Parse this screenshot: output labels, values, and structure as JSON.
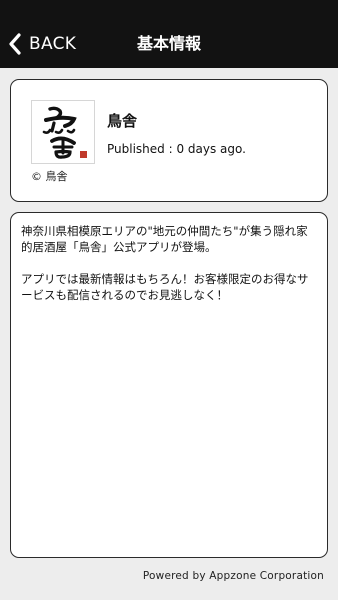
{
  "nav": {
    "back_label": "BACK",
    "title": "基本情報",
    "back_icon": "chevron-left-icon"
  },
  "app": {
    "name": "鳥舎",
    "published": "Published : 0 days ago.",
    "copyright": "© 鳥舎",
    "logo_text": "鳥舎"
  },
  "description": {
    "text": "神奈川県相模原エリアの\"地元の仲間たち\"が集う隠れ家的居酒屋「鳥舎」公式アプリが登場。\n\nアプリでは最新情報はもちろん！お客様限定のお得なサービスも配信されるのでお見逃しなく！"
  },
  "footer": {
    "powered_by": "Powered by Appzone Corporation"
  },
  "colors": {
    "nav_background": "#121212",
    "page_background": "#ededed",
    "card_border": "#2a2a2a",
    "stamp_red": "#c0392b"
  }
}
